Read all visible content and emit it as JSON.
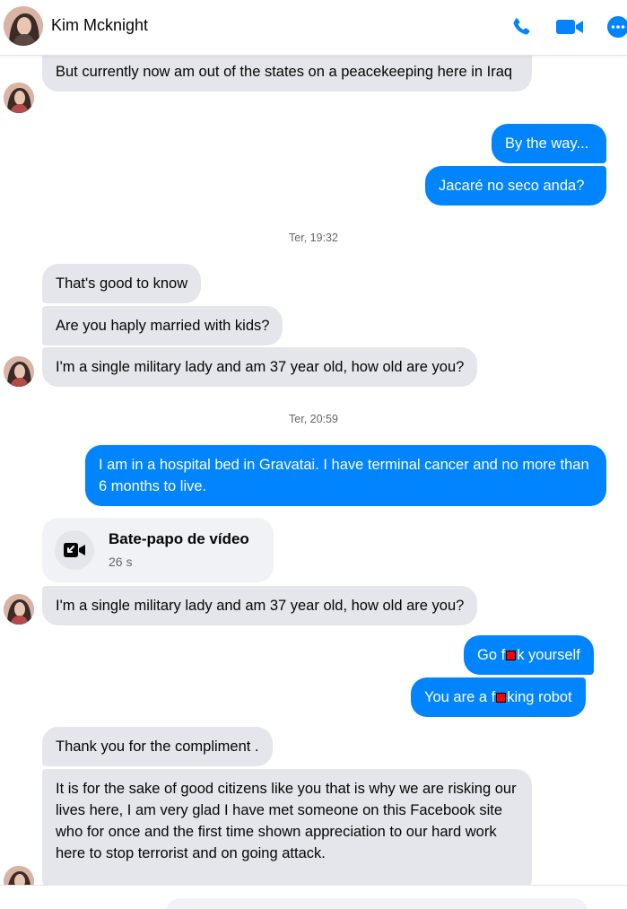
{
  "header": {
    "contact_name": "Kim Mcknight",
    "icons": [
      "phone-icon",
      "video-camera-icon",
      "more-icon"
    ],
    "accent_color": "#0084ff"
  },
  "messages": [
    {
      "side": "in",
      "text": "But currently now am out of the states on a peacekeeping here in Iraq"
    },
    {
      "side": "out",
      "text": "By the way..."
    },
    {
      "side": "out",
      "text": "Jacaré no seco anda?"
    },
    {
      "type": "timestamp",
      "text": "Ter, 19:32"
    },
    {
      "side": "in",
      "text": "That's good to know"
    },
    {
      "side": "in",
      "text": "Are you haply married with kids?"
    },
    {
      "side": "in",
      "text": "I'm a single military lady and am 37 year old, how old are you?"
    },
    {
      "type": "timestamp",
      "text": "Ter, 20:59"
    },
    {
      "side": "out",
      "text": "I am in a hospital bed in Gravatai. I have terminal cancer  and no more than 6 months to live."
    },
    {
      "type": "video_chat",
      "title": "Bate-papo de vídeo",
      "duration": "26 s"
    },
    {
      "side": "in",
      "text": "I'm a single military lady and am 37 year old, how old are you?"
    },
    {
      "side": "out",
      "text_before": "Go f",
      "text_after": "k yourself"
    },
    {
      "side": "out",
      "text_before": "You are a f",
      "text_after": "king robot"
    },
    {
      "side": "in",
      "text": "Thank you for the compliment ."
    },
    {
      "side": "in",
      "text": "It is for the sake of good citizens like you that is why we are risking our lives here, I am very glad I have met someone on this Facebook site who for once and the first time shown appreciation to our hard work here to stop terrorist and on going attack."
    }
  ]
}
